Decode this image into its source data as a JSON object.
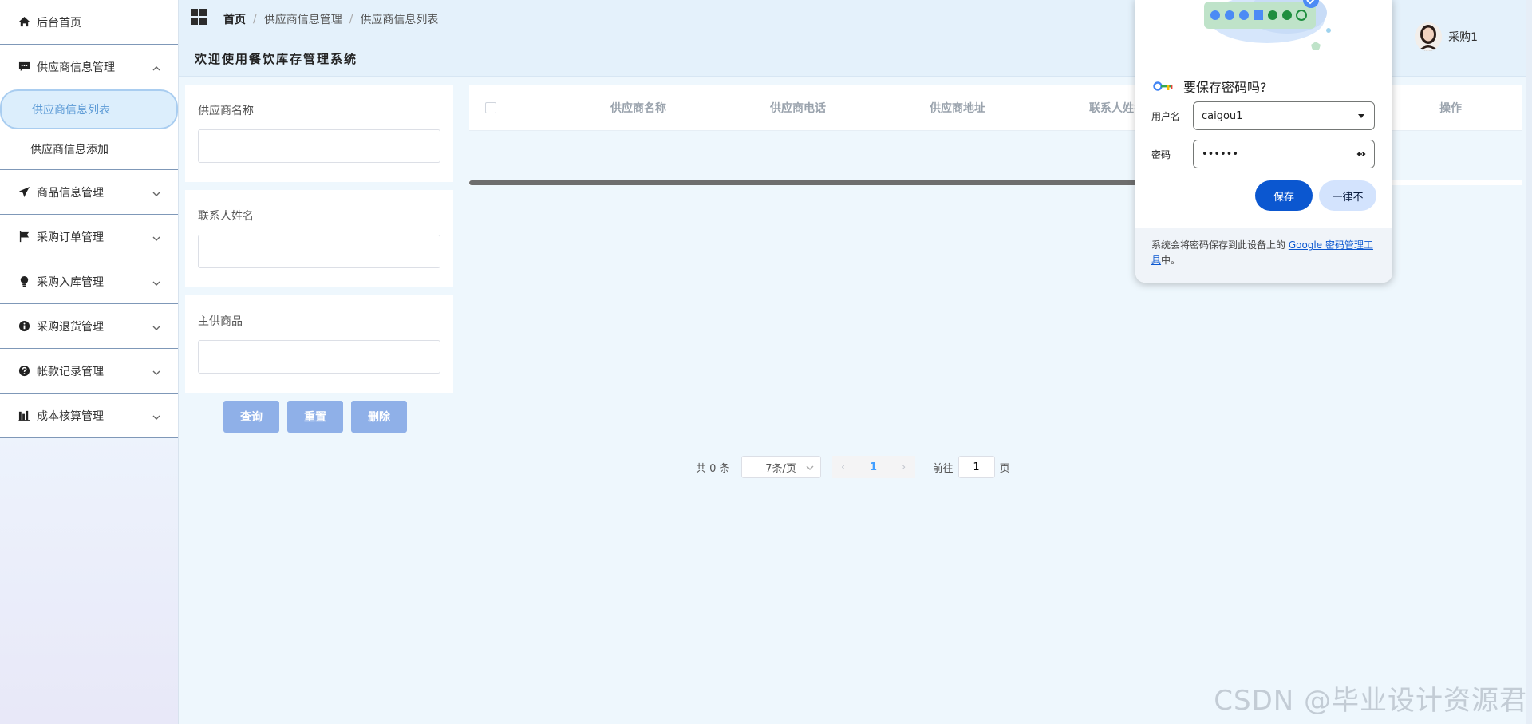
{
  "sidebar": {
    "items": [
      {
        "label": "后台首页",
        "icon": "home-icon"
      },
      {
        "label": "供应商信息管理",
        "icon": "comment-icon"
      },
      {
        "label": "商品信息管理",
        "icon": "paper-plane-icon"
      },
      {
        "label": "采购订单管理",
        "icon": "flag-icon"
      },
      {
        "label": "采购入库管理",
        "icon": "bulb-icon"
      },
      {
        "label": "采购退货管理",
        "icon": "info-icon"
      },
      {
        "label": "帐款记录管理",
        "icon": "question-icon"
      },
      {
        "label": "成本核算管理",
        "icon": "chart-icon"
      }
    ],
    "sub_items": [
      "供应商信息列表",
      "供应商信息添加"
    ]
  },
  "header": {
    "breadcrumb": [
      "首页",
      "供应商信息管理",
      "供应商信息列表"
    ],
    "title": "欢迎使用餐饮库存管理系统",
    "user": "采购1"
  },
  "search": {
    "fields": [
      {
        "label": "供应商名称",
        "value": ""
      },
      {
        "label": "联系人姓名",
        "value": ""
      },
      {
        "label": "主供商品",
        "value": ""
      }
    ],
    "buttons": {
      "query": "查询",
      "reset": "重置",
      "delete": "删除"
    }
  },
  "table": {
    "columns": [
      "供应商名称",
      "供应商电话",
      "供应商地址",
      "联系人姓名"
    ],
    "op_column": "操作"
  },
  "pager": {
    "total": "共 0 条",
    "page_size": "7条/页",
    "current": "1",
    "goto_prefix": "前往",
    "goto_value": "1",
    "goto_suffix": "页"
  },
  "password_popup": {
    "title": "要保存密码吗?",
    "username_label": "用户名",
    "username_value": "caigou1",
    "password_label": "密码",
    "password_value": "••••••",
    "save": "保存",
    "never": "一律不",
    "footer_prefix": "系统会将密码保存到此设备上的 ",
    "footer_link": "Google 密码管理工具",
    "footer_suffix": "中。"
  },
  "watermark": "CSDN @毕业设计资源君",
  "colors": {
    "accent": "#409eff",
    "button": "#8fb0e8",
    "google_blue": "#0b57d0"
  }
}
